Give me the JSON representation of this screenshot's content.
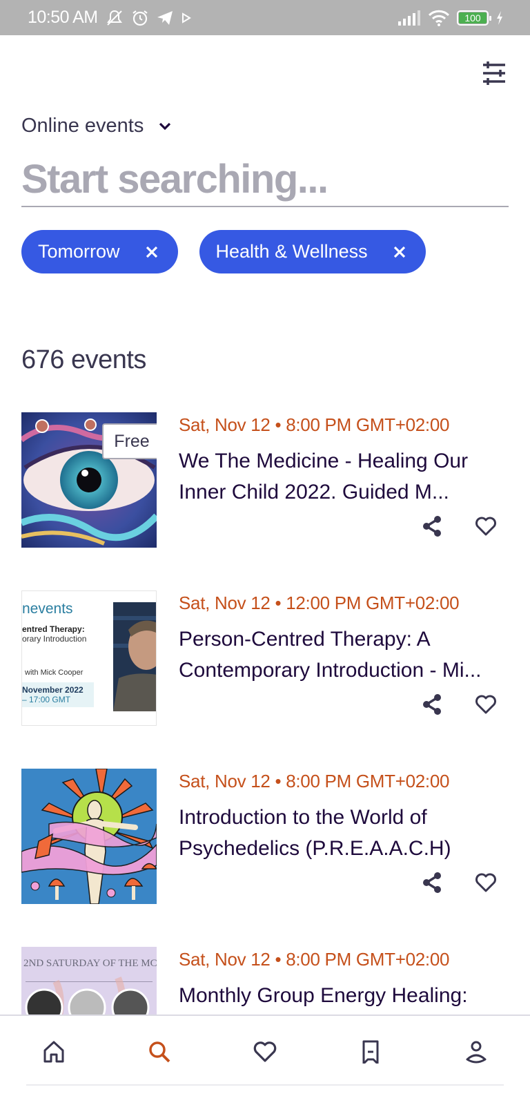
{
  "status_bar": {
    "time": "10:50 AM",
    "battery": "100",
    "icons": [
      "mute-icon",
      "alarm-icon",
      "telegram-icon",
      "play-icon",
      "signal-icon",
      "wifi-icon",
      "battery-icon",
      "charging-icon"
    ]
  },
  "header": {
    "filter_icon": "sliders-icon",
    "location_label": "Online events",
    "search_placeholder": "Start searching..."
  },
  "filters": [
    {
      "label": "Tomorrow"
    },
    {
      "label": "Health & Wellness"
    }
  ],
  "results": {
    "count_label": "676 events"
  },
  "events": [
    {
      "date": "Sat, Nov 12 • 8:00 PM GMT+02:00",
      "title": "We The Medicine -  Healing Our Inner Child 2022. Guided M...",
      "badge": "Free",
      "thumb": "eye-artwork"
    },
    {
      "date": "Sat, Nov 12 • 12:00 PM GMT+02:00",
      "title": "Person-Centred Therapy: A Contemporary Introduction - Mi...",
      "thumb": "therapy-banner",
      "thumb_text": {
        "brand": "nevents",
        "line1": "entred Therapy:",
        "line2": "orary Introduction",
        "line3": "with Mick Cooper",
        "line4": "November 2022",
        "line5": "– 17:00 GMT"
      }
    },
    {
      "date": "Sat, Nov 12 • 8:00 PM GMT+02:00",
      "title": "Introduction to the World of Psychedelics (P.R.E.A.A.C.H)",
      "thumb": "psychedelic-artwork"
    },
    {
      "date": "Sat, Nov 12 • 8:00 PM GMT+02:00",
      "title": "Monthly Group Energy Healing:",
      "thumb": "energy-healing-banner",
      "thumb_text": {
        "line1": "2ND SATURDAY OF THE MC"
      }
    }
  ],
  "bottom_nav": [
    {
      "name": "home",
      "icon": "home-icon",
      "active": false
    },
    {
      "name": "search",
      "icon": "search-icon",
      "active": true
    },
    {
      "name": "likes",
      "icon": "heart-icon",
      "active": false
    },
    {
      "name": "tickets",
      "icon": "ticket-icon",
      "active": false
    },
    {
      "name": "profile",
      "icon": "profile-icon",
      "active": false
    }
  ],
  "colors": {
    "accent_blue": "#3659e3",
    "date_orange": "#c5501b",
    "title_dark": "#1e0a3c",
    "icon_gray": "#39364f",
    "active_nav": "#c5501b"
  }
}
